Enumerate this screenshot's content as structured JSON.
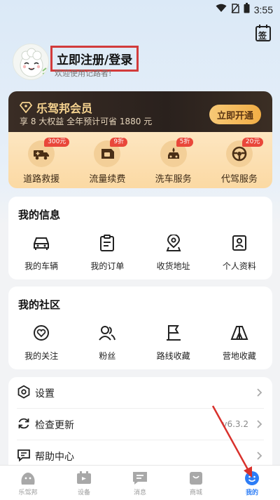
{
  "status_bar": {
    "time": "3:55"
  },
  "header": {
    "checkin_label": "签"
  },
  "profile": {
    "login_label": "立即注册/登录",
    "welcome_text": "欢迎使用记路者!"
  },
  "vip": {
    "title": "乐驾邦会员",
    "subtitle": "享 8 大权益  全年预计可省 1880 元",
    "cta_label": "立即开通",
    "benefits": [
      {
        "label": "道路救援",
        "badge": "300元",
        "icon": "rescue-truck-icon"
      },
      {
        "label": "流量续费",
        "badge": "9折",
        "icon": "sim-card-icon"
      },
      {
        "label": "洗车服务",
        "badge": "5折",
        "icon": "car-wash-icon"
      },
      {
        "label": "代驾服务",
        "badge": "20元",
        "icon": "steering-wheel-icon"
      }
    ]
  },
  "my_info": {
    "title": "我的信息",
    "items": [
      {
        "label": "我的车辆",
        "icon": "car-icon"
      },
      {
        "label": "我的订单",
        "icon": "clipboard-icon"
      },
      {
        "label": "收货地址",
        "icon": "location-pin-icon"
      },
      {
        "label": "个人资料",
        "icon": "profile-card-icon"
      }
    ]
  },
  "community": {
    "title": "我的社区",
    "items": [
      {
        "label": "我的关注",
        "icon": "heart-badge-icon"
      },
      {
        "label": "粉丝",
        "icon": "users-icon"
      },
      {
        "label": "路线收藏",
        "icon": "flag-icon"
      },
      {
        "label": "营地收藏",
        "icon": "tent-icon"
      }
    ]
  },
  "settings_list": [
    {
      "label": "设置",
      "value": "",
      "icon": "settings-hexagon-icon"
    },
    {
      "label": "检查更新",
      "value": "v6.3.2",
      "icon": "refresh-icon"
    },
    {
      "label": "帮助中心",
      "value": "",
      "icon": "help-chat-icon"
    }
  ],
  "tabs": [
    {
      "label": "乐驾邦",
      "icon": "community-blob-icon",
      "active": false
    },
    {
      "label": "设备",
      "icon": "device-icon",
      "active": false
    },
    {
      "label": "消息",
      "icon": "message-icon",
      "active": false
    },
    {
      "label": "商城",
      "icon": "shop-bag-icon",
      "active": false
    },
    {
      "label": "我的",
      "icon": "smiley-icon",
      "active": true
    }
  ],
  "colors": {
    "accent_blue": "#2d7df6",
    "annotation_red": "#d23b3b",
    "vip_gold": "#f6d38f",
    "badge_red": "#e9473a"
  }
}
